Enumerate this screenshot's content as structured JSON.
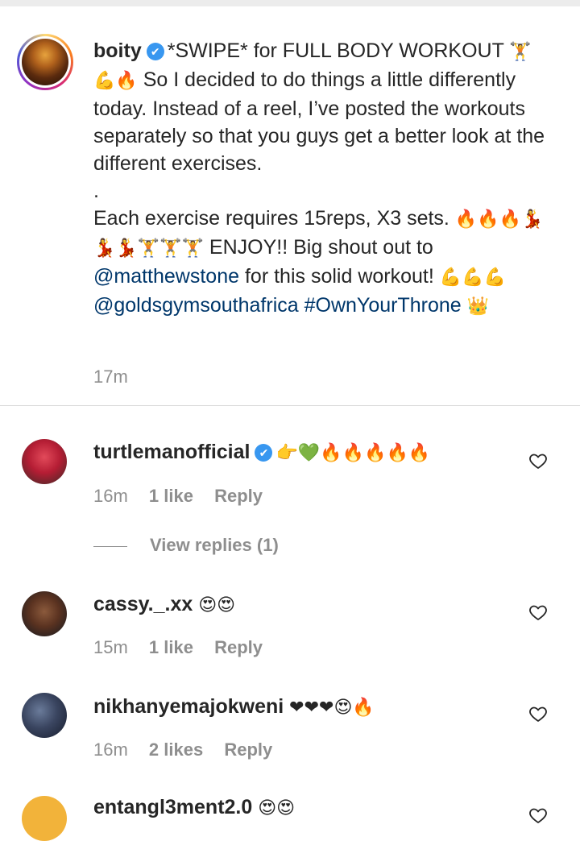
{
  "post": {
    "username": "boity",
    "verified_mark": "✔",
    "caption": {
      "line1_text": "*SWIPE* for FULL BODY WORKOUT",
      "line1_emoji": "🏋",
      "line2_emoji": "💪🔥",
      "line2_text": "So I decided to do things a little differently today. Instead of a reel, I’ve posted the workouts separately so that you guys get a better look at the different exercises.",
      "dot": ".",
      "line3_text": "Each exercise requires 15reps, X3 sets.",
      "line3_emoji": "🔥🔥🔥💃💃💃🏋🏋🏋",
      "line4_text": "ENJOY!! Big shout out to",
      "mention1": "@matthewstone",
      "line5_text": "for this solid workout!",
      "line5_emoji": "💪💪💪",
      "mention2": "@goldsgymsouthafrica",
      "hashtag": "#OwnYourThrone",
      "end_emoji": "👑"
    },
    "time": "17m"
  },
  "comments": [
    {
      "username": "turtlemanofficial",
      "verified": true,
      "verified_mark": "✔",
      "text": "👉💚🔥🔥🔥🔥🔥",
      "time": "16m",
      "likes": "1 like",
      "reply": "Reply",
      "view_replies": "View replies (1)"
    },
    {
      "username": "cassy._.xx",
      "verified": false,
      "text": "😍😍",
      "time": "15m",
      "likes": "1 like",
      "reply": "Reply"
    },
    {
      "username": "nikhanyemajokweni",
      "verified": false,
      "text": "❤❤❤😍🔥",
      "time": "16m",
      "likes": "2 likes",
      "reply": "Reply"
    },
    {
      "username": "entangl3ment2.0",
      "verified": false,
      "text": "😍😍"
    }
  ],
  "icons": {
    "heart": "heart-outline-icon",
    "verified": "verified-badge-icon"
  },
  "colors": {
    "text": "#262626",
    "secondary": "#8e8e8e",
    "link": "#00376b",
    "verified": "#3897f0",
    "divider": "#dbdbdb"
  }
}
